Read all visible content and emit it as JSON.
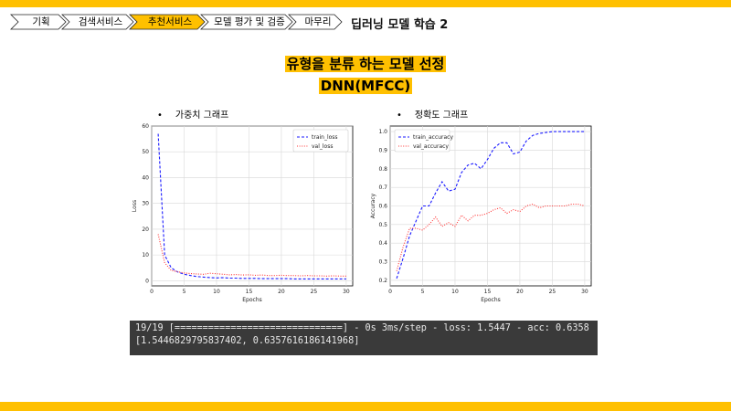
{
  "nav": {
    "steps": [
      "기획",
      "검색서비스",
      "추천서비스",
      "모델 평가 및 검증",
      "마무리"
    ],
    "active_index": 2
  },
  "deck_title": "딥러닝 모델 학습 2",
  "slide": {
    "title_line1": "유형을 분류 하는 모델 선정",
    "title_line2": "DNN(MFCC)"
  },
  "bullets": {
    "left": "가중치 그래프",
    "right": "정확도 그래프",
    "marker": "•"
  },
  "colors": {
    "accent": "#ffc000",
    "train": "#1a1aff",
    "val": "#ff3333",
    "console_bg": "#3a3a3a"
  },
  "chart_data": [
    {
      "type": "line",
      "xlabel": "Epochs",
      "ylabel": "Loss",
      "xlim": [
        0,
        31
      ],
      "ylim": [
        -2,
        60
      ],
      "xticks": [
        0,
        5,
        10,
        15,
        20,
        25,
        30
      ],
      "yticks": [
        0,
        10,
        20,
        30,
        40,
        50,
        60
      ],
      "legend": "top-right",
      "grid": true,
      "x": [
        1,
        2,
        3,
        4,
        5,
        6,
        7,
        8,
        9,
        10,
        11,
        12,
        13,
        14,
        15,
        16,
        17,
        18,
        19,
        20,
        21,
        22,
        23,
        24,
        25,
        26,
        27,
        28,
        29,
        30
      ],
      "series": [
        {
          "name": "train_loss",
          "style": "dashed",
          "color": "#1a1aff",
          "values": [
            57,
            10,
            5,
            3.4,
            2.5,
            2,
            1.6,
            1.4,
            1.2,
            1.1,
            1.2,
            1.0,
            1.0,
            0.9,
            0.9,
            0.9,
            0.8,
            0.8,
            0.8,
            0.8,
            0.8,
            0.7,
            0.7,
            0.7,
            0.7,
            0.7,
            0.7,
            0.7,
            0.7,
            0.7
          ]
        },
        {
          "name": "val_loss",
          "style": "dotted",
          "color": "#ff3333",
          "values": [
            18,
            7,
            4,
            3.5,
            3,
            2.8,
            2.6,
            2.5,
            2.9,
            2.7,
            2.5,
            2.3,
            2.4,
            2.2,
            2.3,
            2.1,
            2.2,
            2.0,
            2.0,
            2.1,
            2.0,
            2.0,
            1.9,
            2.0,
            1.9,
            1.9,
            1.8,
            1.9,
            1.8,
            1.8
          ]
        }
      ]
    },
    {
      "type": "line",
      "xlabel": "Epochs",
      "ylabel": "Accuracy",
      "xlim": [
        0,
        31
      ],
      "ylim": [
        0.17,
        1.03
      ],
      "xticks": [
        0,
        5,
        10,
        15,
        20,
        25,
        30
      ],
      "yticks": [
        0.2,
        0.3,
        0.4,
        0.5,
        0.6,
        0.7,
        0.8,
        0.9,
        1.0
      ],
      "legend": "top-left",
      "grid": true,
      "x": [
        1,
        2,
        3,
        4,
        5,
        6,
        7,
        8,
        9,
        10,
        11,
        12,
        13,
        14,
        15,
        16,
        17,
        18,
        19,
        20,
        21,
        22,
        23,
        24,
        25,
        26,
        27,
        28,
        29,
        30
      ],
      "series": [
        {
          "name": "train_accuracy",
          "style": "dashed",
          "color": "#1a1aff",
          "values": [
            0.21,
            0.32,
            0.44,
            0.52,
            0.6,
            0.6,
            0.67,
            0.73,
            0.68,
            0.69,
            0.78,
            0.82,
            0.83,
            0.8,
            0.85,
            0.91,
            0.94,
            0.94,
            0.88,
            0.89,
            0.95,
            0.98,
            0.99,
            0.995,
            1.0,
            1.0,
            1.0,
            1.0,
            1.0,
            1.0
          ]
        },
        {
          "name": "val_accuracy",
          "style": "dotted",
          "color": "#ff3333",
          "values": [
            0.25,
            0.38,
            0.48,
            0.48,
            0.47,
            0.5,
            0.54,
            0.49,
            0.51,
            0.49,
            0.55,
            0.52,
            0.55,
            0.55,
            0.56,
            0.58,
            0.59,
            0.56,
            0.58,
            0.57,
            0.6,
            0.61,
            0.59,
            0.6,
            0.6,
            0.6,
            0.6,
            0.61,
            0.61,
            0.6
          ]
        }
      ]
    }
  ],
  "console": {
    "line1": "19/19 [==============================] - 0s 3ms/step - loss: 1.5447 - acc: 0.6358",
    "line2": "[1.5446829795837402, 0.6357616186141968]"
  }
}
